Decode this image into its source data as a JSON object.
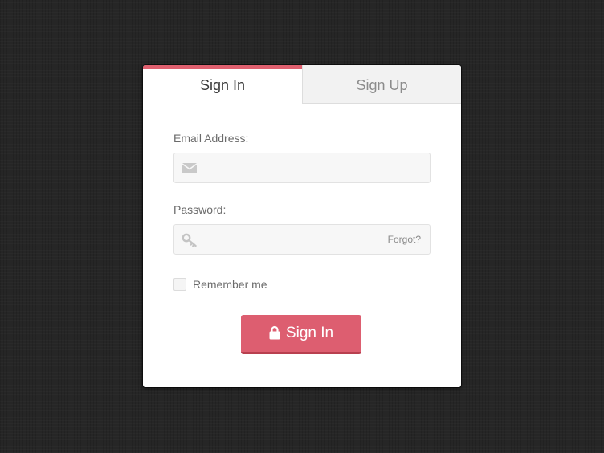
{
  "tabs": {
    "signin_label": "Sign In",
    "signup_label": "Sign Up",
    "active": "signin"
  },
  "form": {
    "email_label": "Email Address:",
    "email_value": "",
    "password_label": "Password:",
    "password_value": "",
    "forgot_label": "Forgot?",
    "remember_label": "Remember me",
    "remember_checked": false,
    "submit_label": "Sign In"
  },
  "icons": {
    "email": "envelope-icon",
    "password": "key-icon",
    "submit": "lock-icon"
  },
  "colors": {
    "accent": "#dd5e70",
    "accent_dark": "#b8404f",
    "background": "#262626",
    "card": "#ffffff"
  }
}
